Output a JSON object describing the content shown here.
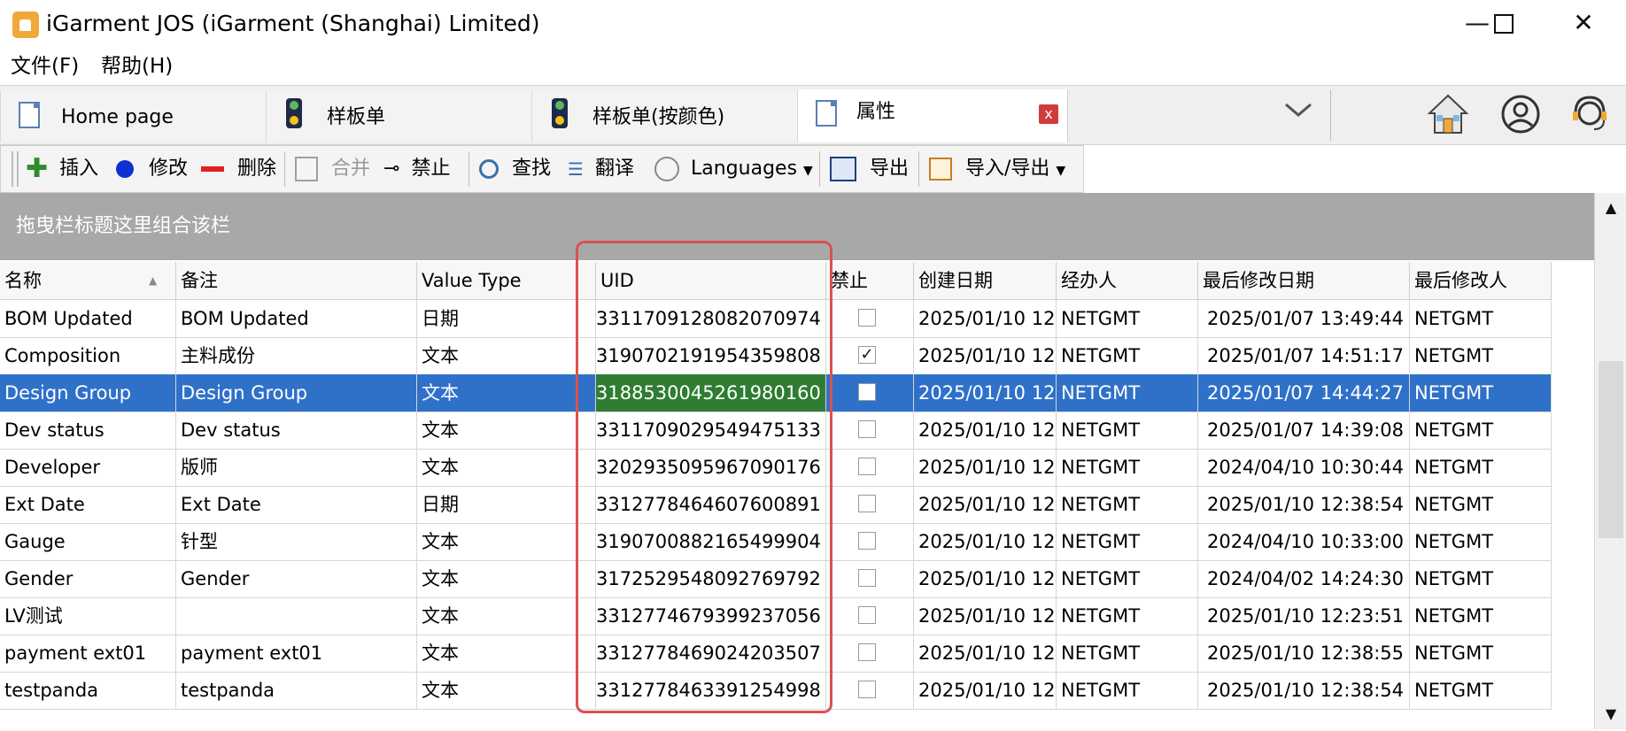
{
  "window": {
    "title": "iGarment JOS (iGarment (Shanghai) Limited)",
    "controls": {
      "minimize": "—",
      "close": "✕"
    }
  },
  "menu": [
    "文件(F)",
    "帮助(H)"
  ],
  "tabs": [
    {
      "label": "Home page",
      "icon": "document-icon"
    },
    {
      "label": "样板单",
      "icon": "traffic-light-icon"
    },
    {
      "label": "样板单(按颜色)",
      "icon": "traffic-light-icon"
    },
    {
      "label": "属性",
      "icon": "document-icon",
      "active": true
    }
  ],
  "tab_close": "x",
  "toolbar": {
    "insert": "插入",
    "modify": "修改",
    "delete": "删除",
    "merge": "合并",
    "disable": "禁止",
    "find": "查找",
    "translate": "翻译",
    "languages": "Languages",
    "export": "导出",
    "import_export": "导入/导出"
  },
  "group_panel_text": "拖曳栏标题这里组合该栏",
  "grid": {
    "columns": [
      "名称",
      "备注",
      "Value Type",
      "UID",
      "禁止",
      "创建日期",
      "经办人",
      "最后修改日期",
      "最后修改人"
    ],
    "sort_indicator": "▲",
    "rows": [
      {
        "name": "BOM Updated",
        "note": "BOM Updated",
        "type": "日期",
        "uid": "3311709128082070974",
        "disabled": false,
        "created": "2025/01/10 12:",
        "handler": "NETGMT",
        "modified": "2025/01/07 13:49:44",
        "modifier": "NETGMT"
      },
      {
        "name": "Composition",
        "note": "主料成份",
        "type": "文本",
        "uid": "3190702191954359808",
        "disabled": true,
        "created": "2025/01/10 12:",
        "handler": "NETGMT",
        "modified": "2025/01/07 14:51:17",
        "modifier": "NETGMT"
      },
      {
        "name": "Design Group",
        "note": "Design Group",
        "type": "文本",
        "uid": "3188530045261980160",
        "disabled": false,
        "created": "2025/01/10 12:",
        "handler": "NETGMT",
        "modified": "2025/01/07 14:44:27",
        "modifier": "NETGMT",
        "selected": true
      },
      {
        "name": "Dev status",
        "note": "Dev status",
        "type": "文本",
        "uid": "3311709029549475133",
        "disabled": false,
        "created": "2025/01/10 12:",
        "handler": "NETGMT",
        "modified": "2025/01/07 14:39:08",
        "modifier": "NETGMT"
      },
      {
        "name": "Developer",
        "note": "版师",
        "type": "文本",
        "uid": "3202935095967090176",
        "disabled": false,
        "created": "2025/01/10 12:",
        "handler": "NETGMT",
        "modified": "2024/04/10 10:30:44",
        "modifier": "NETGMT"
      },
      {
        "name": "Ext Date",
        "note": "Ext Date",
        "type": "日期",
        "uid": "3312778464607600891",
        "disabled": false,
        "created": "2025/01/10 12:",
        "handler": "NETGMT",
        "modified": "2025/01/10 12:38:54",
        "modifier": "NETGMT"
      },
      {
        "name": "Gauge",
        "note": "针型",
        "type": "文本",
        "uid": "3190700882165499904",
        "disabled": false,
        "created": "2025/01/10 12:",
        "handler": "NETGMT",
        "modified": "2024/04/10 10:33:00",
        "modifier": "NETGMT"
      },
      {
        "name": "Gender",
        "note": "Gender",
        "type": "文本",
        "uid": "3172529548092769792",
        "disabled": false,
        "created": "2025/01/10 12:",
        "handler": "NETGMT",
        "modified": "2024/04/02 14:24:30",
        "modifier": "NETGMT"
      },
      {
        "name": "LV测试",
        "note": "",
        "type": "文本",
        "uid": "3312774679399237056",
        "disabled": false,
        "created": "2025/01/10 12:",
        "handler": "NETGMT",
        "modified": "2025/01/10 12:23:51",
        "modifier": "NETGMT"
      },
      {
        "name": "payment ext01",
        "note": "payment ext01",
        "type": "文本",
        "uid": "3312778469024203507",
        "disabled": false,
        "created": "2025/01/10 12:",
        "handler": "NETGMT",
        "modified": "2025/01/10 12:38:55",
        "modifier": "NETGMT"
      },
      {
        "name": "testpanda",
        "note": "testpanda",
        "type": "文本",
        "uid": "3312778463391254998",
        "disabled": false,
        "created": "2025/01/10 12:",
        "handler": "NETGMT",
        "modified": "2025/01/10 12:38:54",
        "modifier": "NETGMT"
      }
    ]
  },
  "colors": {
    "selected_row": "#2f71c9",
    "selected_uid_cell": "#2e7d32",
    "highlight_border": "#d9534f",
    "group_panel": "#a8a8a8"
  }
}
